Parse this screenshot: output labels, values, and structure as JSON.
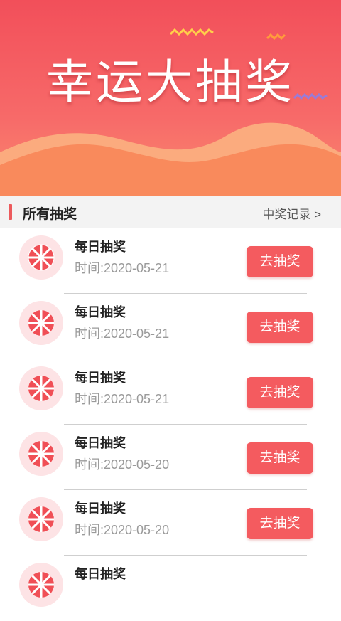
{
  "banner": {
    "title": "幸运大抽奖",
    "colors": {
      "top": "#f24f5a",
      "wave_front": "#f98a5c",
      "wave_back": "#fbab7e"
    }
  },
  "section": {
    "title": "所有抽奖",
    "link_label": "中奖记录 >"
  },
  "lottery_list": [
    {
      "title": "每日抽奖",
      "time": "时间:2020-05-21",
      "button_label": "去抽奖"
    },
    {
      "title": "每日抽奖",
      "time": "时间:2020-05-21",
      "button_label": "去抽奖"
    },
    {
      "title": "每日抽奖",
      "time": "时间:2020-05-21",
      "button_label": "去抽奖"
    },
    {
      "title": "每日抽奖",
      "time": "时间:2020-05-20",
      "button_label": "去抽奖"
    },
    {
      "title": "每日抽奖",
      "time": "时间:2020-05-20",
      "button_label": "去抽奖"
    },
    {
      "title": "每日抽奖",
      "time": "",
      "button_label": ""
    }
  ],
  "icons": {
    "list_item": "lottery-wheel-icon",
    "section_marker": "section-bar"
  },
  "accent_color": "#f45b5f"
}
